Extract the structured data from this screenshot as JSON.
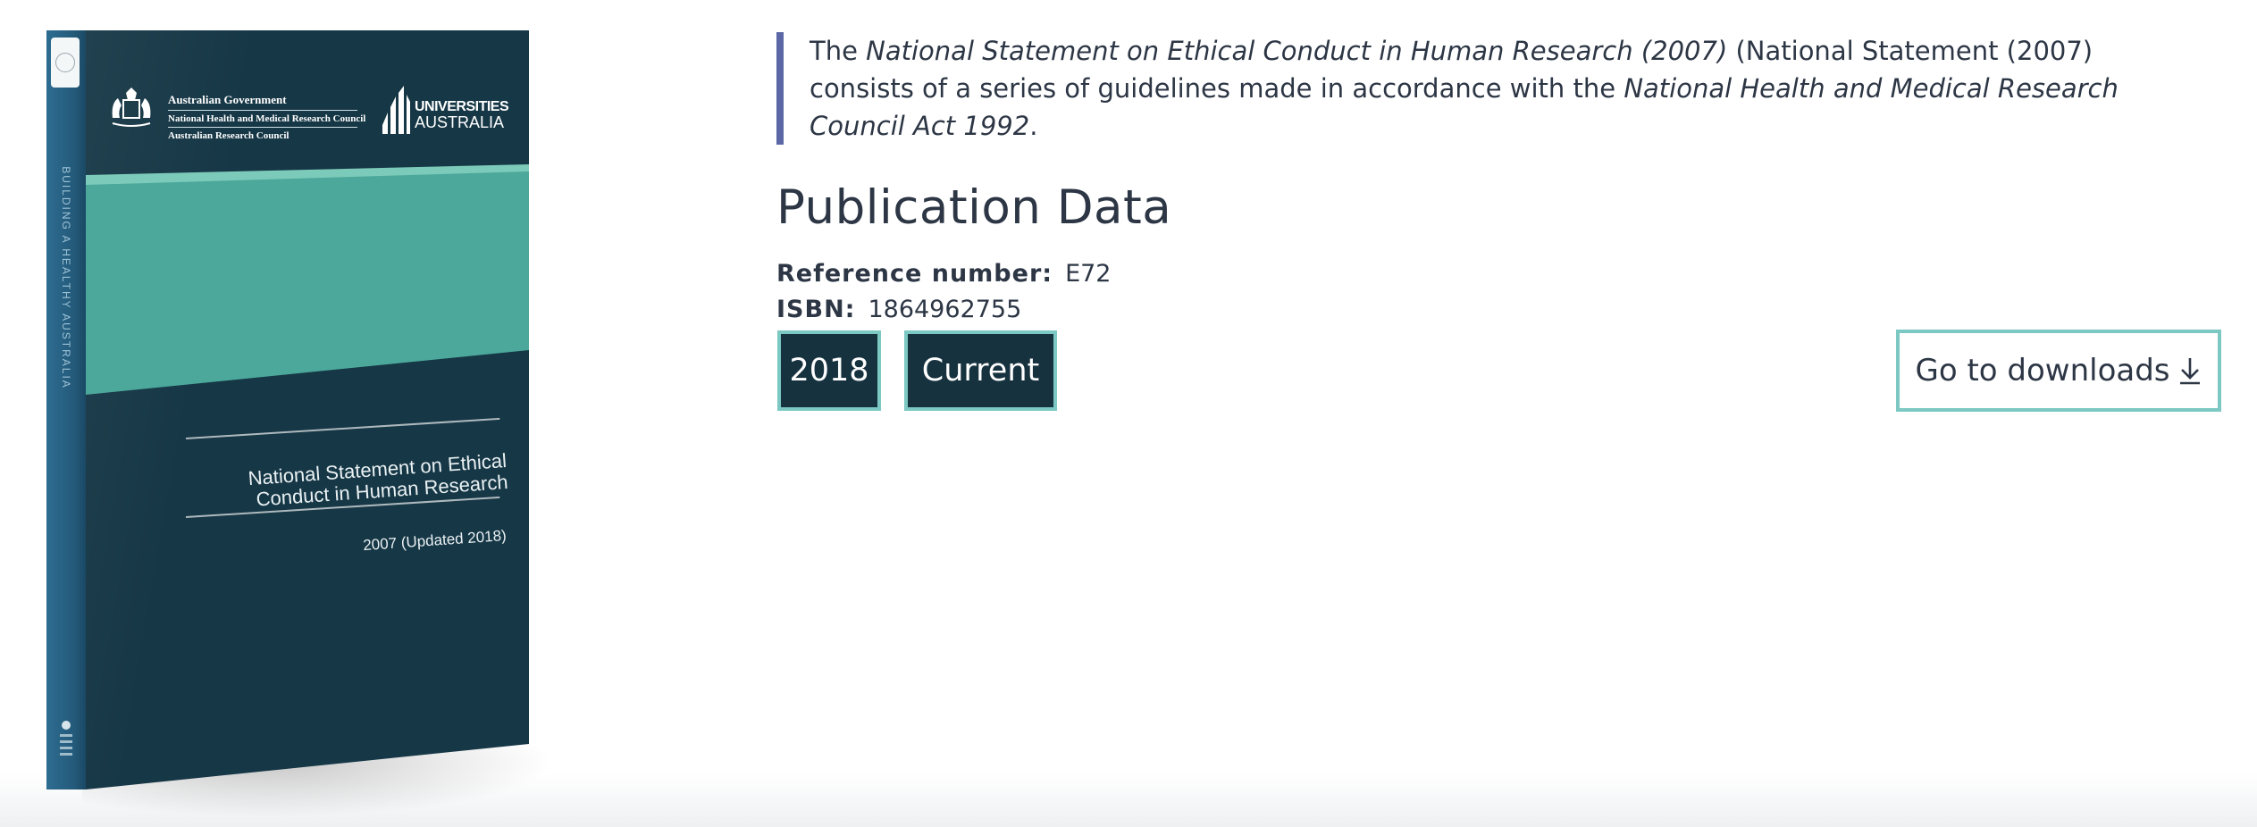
{
  "book": {
    "spine_text": "BUILDING A HEALTHY AUSTRALIA",
    "cover_title_line1": "National Statement on Ethical",
    "cover_title_line2": "Conduct in Human Research",
    "cover_edition": "2007 (Updated 2018)",
    "gov_line1": "Australian Government",
    "gov_line2": "National Health and Medical Research Council",
    "gov_line3": "Australian Research Council",
    "ua_line1": "UNIVERSITIES",
    "ua_line2": "AUSTRALIA",
    "colors": {
      "cover": "#163746",
      "spine": "#2d6c91",
      "teal_band": "#4ba89b",
      "light_band": "#7ccab9"
    }
  },
  "intro": {
    "part1": "The ",
    "title_italic": "National Statement on Ethical Conduct in Human Research (2007)",
    "part2": " (National Statement (2007) consists of a series of guidelines made in accordance with the ",
    "act_italic": "National Health and Medical Research Council Act 1992",
    "part3": "."
  },
  "publication": {
    "heading": "Publication Data",
    "reference_label": "Reference number:",
    "reference_value": "E72",
    "isbn_label": "ISBN:",
    "isbn_value": "1864962755",
    "tags": [
      "2018",
      "Current"
    ]
  },
  "downloads": {
    "label": "Go to downloads",
    "icon": "download-arrow-icon"
  },
  "colors": {
    "text": "#2d3645",
    "quote_border": "#5c68a6",
    "tag_bg": "#16323f",
    "accent_border": "#7cc8c2"
  }
}
